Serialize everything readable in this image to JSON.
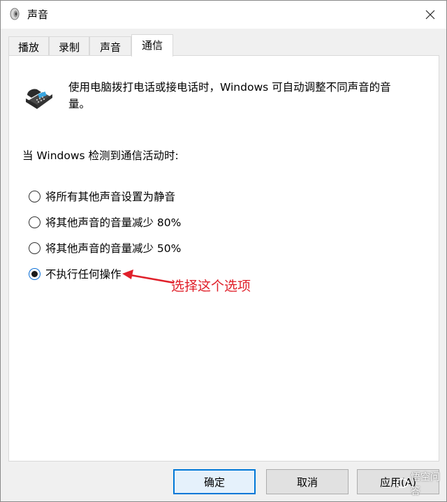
{
  "window": {
    "title": "声音"
  },
  "tabs": [
    {
      "label": "播放"
    },
    {
      "label": "录制"
    },
    {
      "label": "声音"
    },
    {
      "label": "通信"
    }
  ],
  "panel": {
    "description": "使用电脑拨打电话或接电话时，Windows 可自动调整不同声音的音量。",
    "section_label": "当 Windows 检测到通信活动时:",
    "options": [
      {
        "label": "将所有其他声音设置为静音",
        "checked": false
      },
      {
        "label": "将其他声音的音量减少 80%",
        "checked": false
      },
      {
        "label": "将其他声音的音量减少 50%",
        "checked": false
      },
      {
        "label": "不执行任何操作",
        "checked": true
      }
    ],
    "annotation": "选择这个选项",
    "annotation_color": "#e0202a"
  },
  "buttons": {
    "ok": "确定",
    "cancel": "取消",
    "apply": "应用(A)"
  },
  "watermark": "悟空问答",
  "accent_color": "#0078d7"
}
